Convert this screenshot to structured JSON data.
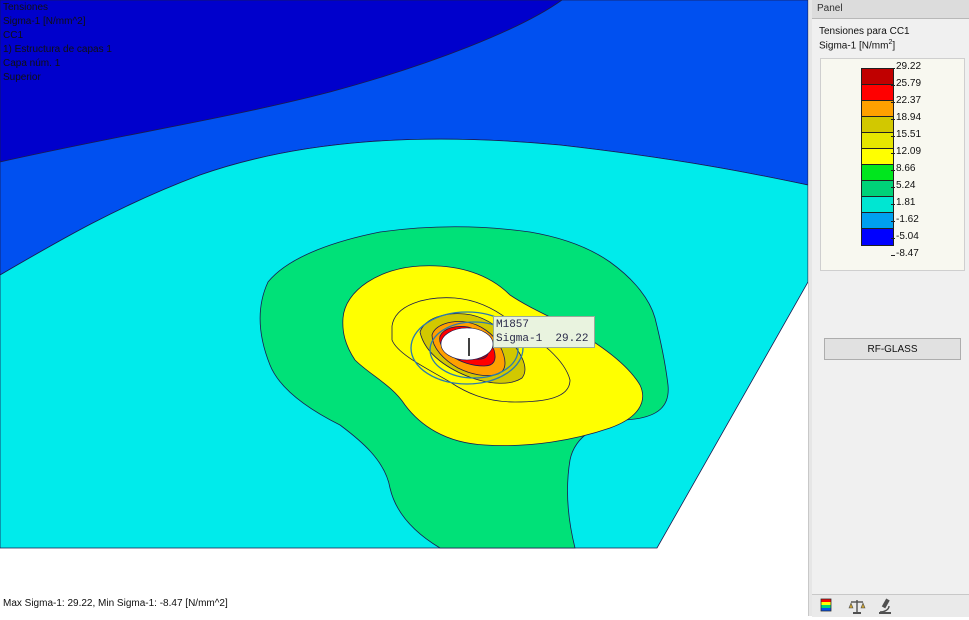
{
  "info_lines": [
    "Tensiones",
    "Sigma-1 [N/mm^2]",
    "CC1",
    "1) Estructura de capas 1",
    "Capa núm. 1",
    "Superior"
  ],
  "tooltip": {
    "node": "M1857",
    "label": "Sigma-1",
    "value": "29.22"
  },
  "status": "Max Sigma-1: 29.22, Min Sigma-1: -8.47 [N/mm^2]",
  "panel": {
    "header": "Panel",
    "title": "Tensiones para CC1",
    "unit_base": "Sigma-1 [N/mm",
    "unit_exp": "2",
    "unit_end": "]",
    "button_label": "RF-GLASS"
  },
  "legend": {
    "values": [
      "29.22",
      "25.79",
      "22.37",
      "18.94",
      "15.51",
      "12.09",
      "8.66",
      "5.24",
      "1.81",
      "-1.62",
      "-5.04",
      "-8.47"
    ],
    "colors": [
      "#c00000",
      "#ff0000",
      "#ffa000",
      "#d2c800",
      "#e6e600",
      "#ffff00",
      "#00e61e",
      "#00d278",
      "#00e6d2",
      "#00a0f0",
      "#0000ff",
      "#0000a0"
    ]
  },
  "plot_colors": {
    "deep_blue": "#0000cc",
    "blue": "#0050f0",
    "cyan": "#00ebeb",
    "green": "#00e178",
    "yellow": "#ffff00",
    "olive": "#d2c800",
    "orange": "#ffa000",
    "red": "#ff0000",
    "dark_red": "#c00000"
  },
  "icons": [
    "legend-colors-icon",
    "balance-icon",
    "microscope-icon"
  ]
}
